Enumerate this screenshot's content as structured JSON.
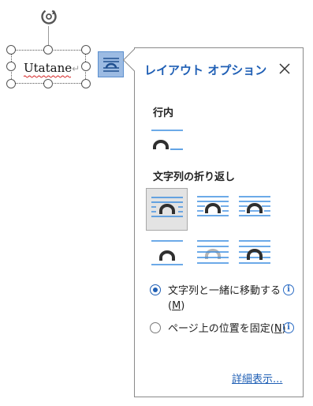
{
  "textbox": {
    "text": "Utatane",
    "paragraph_mark": "↵"
  },
  "popup": {
    "title": "レイアウト オプション",
    "close_label": "×",
    "inline_section": "行内",
    "wrap_section": "文字列の折り返し",
    "wrap_options": [
      {
        "name": "square",
        "selected": true
      },
      {
        "name": "tight"
      },
      {
        "name": "through"
      },
      {
        "name": "top-and-bottom"
      },
      {
        "name": "behind-text"
      },
      {
        "name": "in-front-of-text"
      }
    ],
    "radio_move_with_text": {
      "label_pre": "文字列と一緒に移動する(",
      "accesskey": "M",
      "label_post": ")",
      "checked": true
    },
    "radio_fix_position": {
      "label_pre": "ページ上の位置を固定(",
      "accesskey": "N",
      "label_post": ")",
      "checked": false
    },
    "more_link": "詳細表示..."
  },
  "colors": {
    "accent": "#1f5fb5",
    "line_blue": "#3b8de0",
    "shape_dark": "#2f2f2f",
    "shape_faded": "#b5b5b5",
    "selected_bg": "#e3e3e3"
  }
}
